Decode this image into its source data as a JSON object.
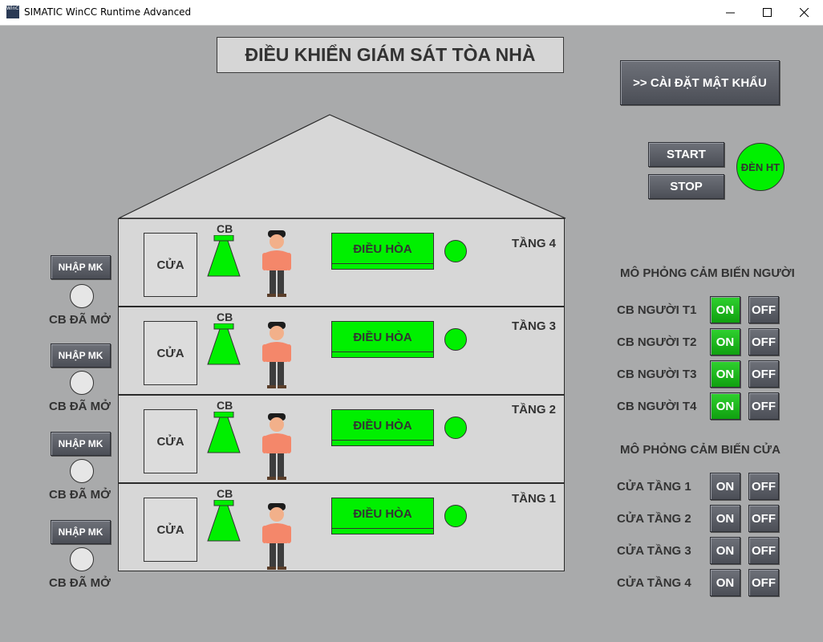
{
  "window": {
    "title": "SIMATIC WinCC Runtime Advanced",
    "icon_text": "WinCC"
  },
  "header": {
    "title": "ĐIỀU KHIỂN GIÁM SÁT TÒA NHÀ"
  },
  "password_button": ">> CÀI ĐẶT MẬT KHẨU",
  "controls": {
    "start": "START",
    "stop": "STOP",
    "system_lamp": "ĐÈN HT"
  },
  "floors": [
    {
      "label": "TẦNG 4",
      "door": "CỬA",
      "cb": "CB",
      "ac": "ĐIỀU HÒA"
    },
    {
      "label": "TẦNG 3",
      "door": "CỬA",
      "cb": "CB",
      "ac": "ĐIỀU HÒA"
    },
    {
      "label": "TẦNG 2",
      "door": "CỬA",
      "cb": "CB",
      "ac": "ĐIỀU HÒA"
    },
    {
      "label": "TẦNG 1",
      "door": "CỬA",
      "cb": "CB",
      "ac": "ĐIỀU HÒA"
    }
  ],
  "left_panel": [
    {
      "button": "NHẬP MK",
      "status": "CB ĐÃ MỞ"
    },
    {
      "button": "NHẬP MK",
      "status": "CB ĐÃ MỞ"
    },
    {
      "button": "NHẬP MK",
      "status": "CB ĐÃ MỞ"
    },
    {
      "button": "NHẬP MK",
      "status": "CB ĐÃ MỞ"
    }
  ],
  "person_sensor": {
    "title": "MÔ PHỎNG CẢM BIẾN NGƯỜI",
    "rows": [
      {
        "label": "CB NGƯỜI T1",
        "on": "ON",
        "off": "OFF"
      },
      {
        "label": "CB NGƯỜI T2",
        "on": "ON",
        "off": "OFF"
      },
      {
        "label": "CB NGƯỜI T3",
        "on": "ON",
        "off": "OFF"
      },
      {
        "label": "CB NGƯỜI T4",
        "on": "ON",
        "off": "OFF"
      }
    ]
  },
  "door_sensor": {
    "title": "MÔ PHỎNG CẢM BIẾN CỬA",
    "rows": [
      {
        "label": "CỬA TẦNG 1",
        "on": "ON",
        "off": "OFF"
      },
      {
        "label": "CỬA TẦNG 2",
        "on": "ON",
        "off": "OFF"
      },
      {
        "label": "CỬA TẦNG 3",
        "on": "ON",
        "off": "OFF"
      },
      {
        "label": "CỬA TẦNG 4",
        "on": "ON",
        "off": "OFF"
      }
    ]
  },
  "colors": {
    "active_green": "#00f000",
    "background": "#a9aaab",
    "button": "#54575e"
  }
}
